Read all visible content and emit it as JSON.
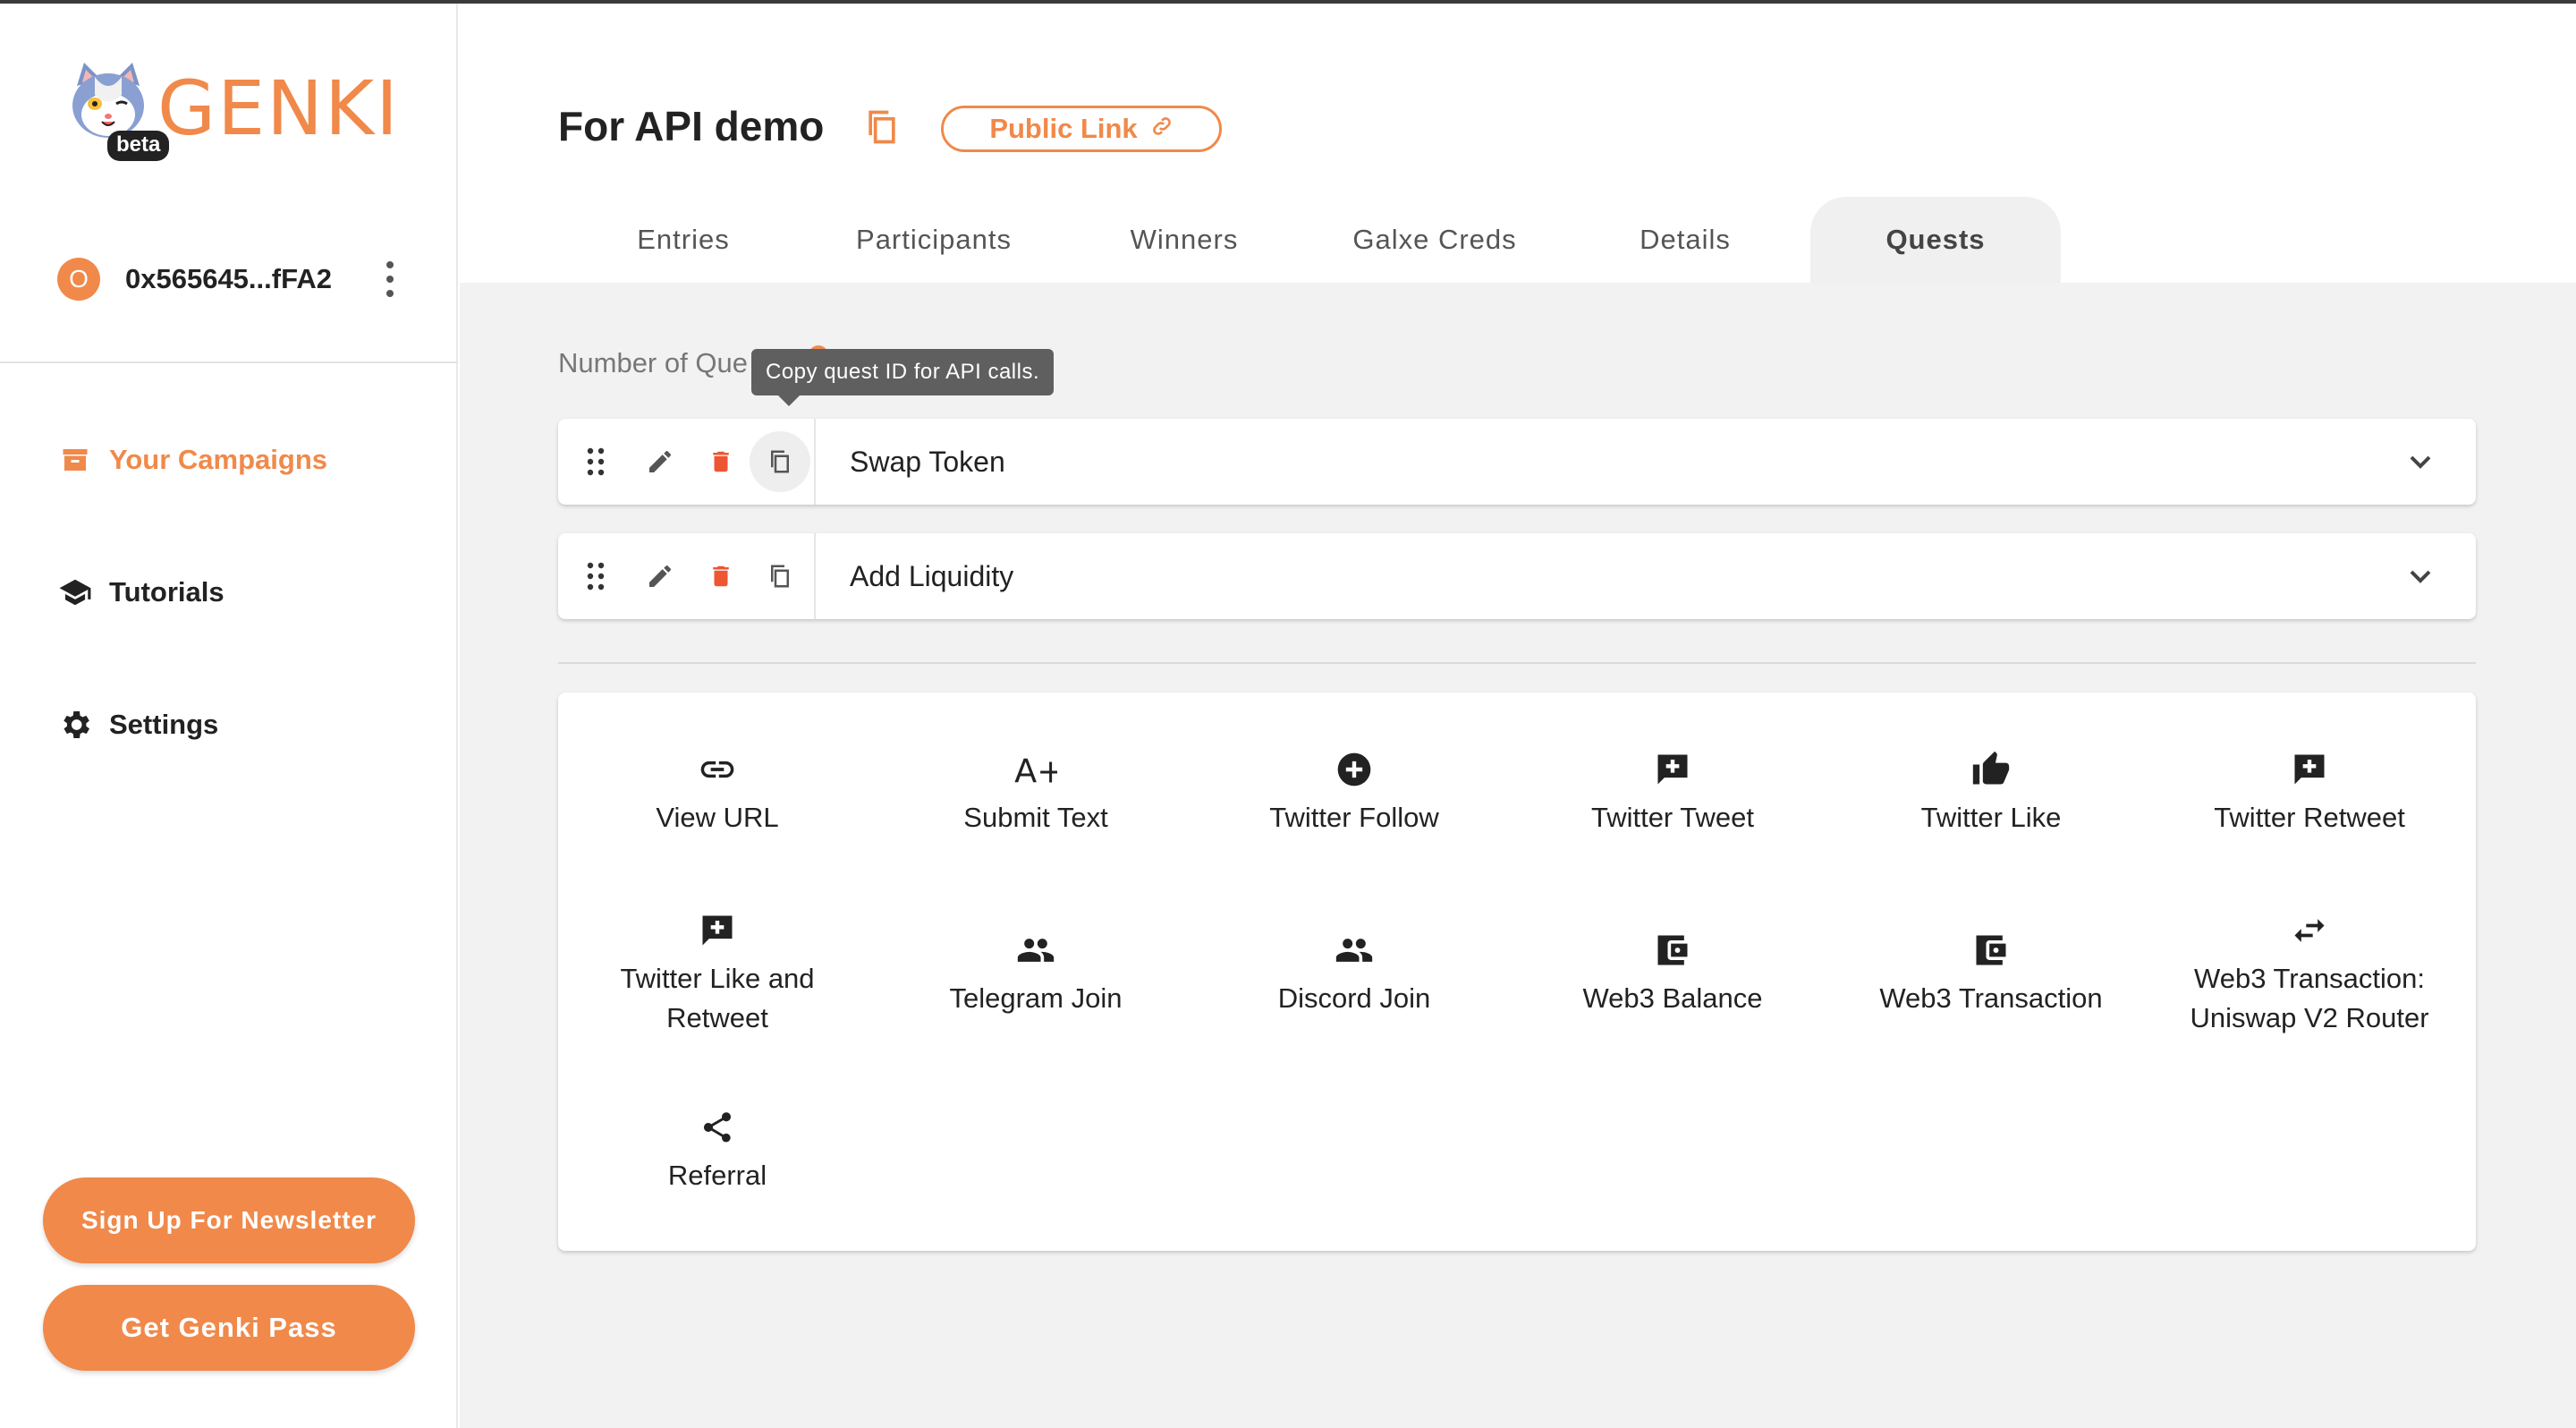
{
  "app": {
    "name": "GENKI",
    "badge": "beta",
    "brand_color": "#f0894a"
  },
  "account": {
    "avatar_letter": "O",
    "address": "0x565645...fFA2"
  },
  "sidebar": {
    "items": [
      {
        "label": "Your Campaigns",
        "icon": "campaign-icon",
        "active": true
      },
      {
        "label": "Tutorials",
        "icon": "graduation-cap-icon",
        "active": false
      },
      {
        "label": "Settings",
        "icon": "gear-icon",
        "active": false
      }
    ],
    "newsletter_button": "Sign Up For Newsletter",
    "pass_button": "Get Genki Pass"
  },
  "header": {
    "title": "For API demo",
    "public_link": "Public Link"
  },
  "tabs": [
    {
      "label": "Entries",
      "active": false
    },
    {
      "label": "Participants",
      "active": false
    },
    {
      "label": "Winners",
      "active": false
    },
    {
      "label": "Galxe Creds",
      "active": false
    },
    {
      "label": "Details",
      "active": false
    },
    {
      "label": "Quests",
      "active": true
    }
  ],
  "quests": {
    "count_label": "Number of Que",
    "tooltip": "Copy quest ID for API calls.",
    "rows": [
      {
        "name": "Swap Token"
      },
      {
        "name": "Add Liquidity"
      }
    ]
  },
  "quest_types": [
    {
      "label": "View URL",
      "icon": "link-icon"
    },
    {
      "label": "Submit Text",
      "icon": "a-plus-icon"
    },
    {
      "label": "Twitter Follow",
      "icon": "add-circle-icon"
    },
    {
      "label": "Twitter Tweet",
      "icon": "add-comment-icon"
    },
    {
      "label": "Twitter Like",
      "icon": "thumb-up-icon"
    },
    {
      "label": "Twitter Retweet",
      "icon": "add-comment-icon"
    },
    {
      "label": "Twitter Like and\nRetweet",
      "icon": "add-comment-icon"
    },
    {
      "label": "Telegram Join",
      "icon": "people-icon"
    },
    {
      "label": "Discord Join",
      "icon": "people-icon"
    },
    {
      "label": "Web3 Balance",
      "icon": "wallet-icon"
    },
    {
      "label": "Web3 Transaction",
      "icon": "wallet-icon"
    },
    {
      "label": "Web3 Transaction:\nUniswap V2 Router",
      "icon": "swap-arrows-icon"
    },
    {
      "label": "Referral",
      "icon": "share-icon"
    }
  ]
}
